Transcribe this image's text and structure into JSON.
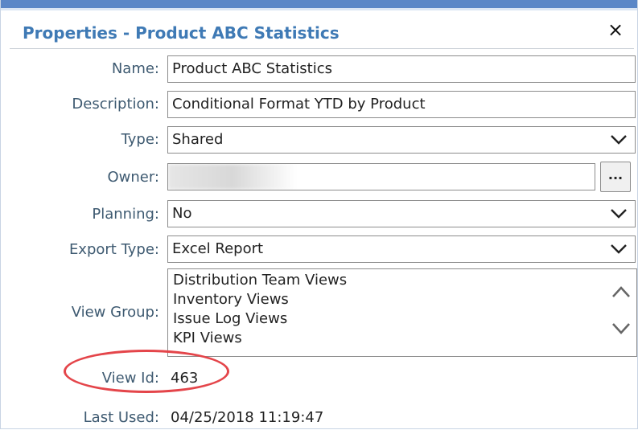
{
  "dialog": {
    "title": "Properties - Product ABC Statistics",
    "close_icon": "×"
  },
  "form": {
    "name_label": "Name:",
    "name_value": "Product ABC Statistics",
    "description_label": "Description:",
    "description_value": "Conditional Format YTD by Product",
    "type_label": "Type:",
    "type_value": "Shared",
    "owner_label": "Owner:",
    "owner_button_label": "...",
    "planning_label": "Planning:",
    "planning_value": "No",
    "export_type_label": "Export Type:",
    "export_type_value": "Excel Report",
    "view_group_label": "View Group:",
    "view_group_items": [
      "Distribution Team Views",
      "Inventory Views",
      "Issue Log Views",
      "KPI Views"
    ],
    "view_id_label": "View Id:",
    "view_id_value": "463",
    "last_used_label": "Last Used:",
    "last_used_value": "04/25/2018 11:19:47"
  },
  "colors": {
    "title": "#3f7ab5",
    "label": "#3e5a71",
    "highlight_ellipse": "#e4454a",
    "top_strip": "#5b87c7"
  },
  "icons": {
    "select": "chevron-down-icon",
    "scroll_up": "chevron-up-icon",
    "scroll_down": "chevron-down-icon"
  }
}
